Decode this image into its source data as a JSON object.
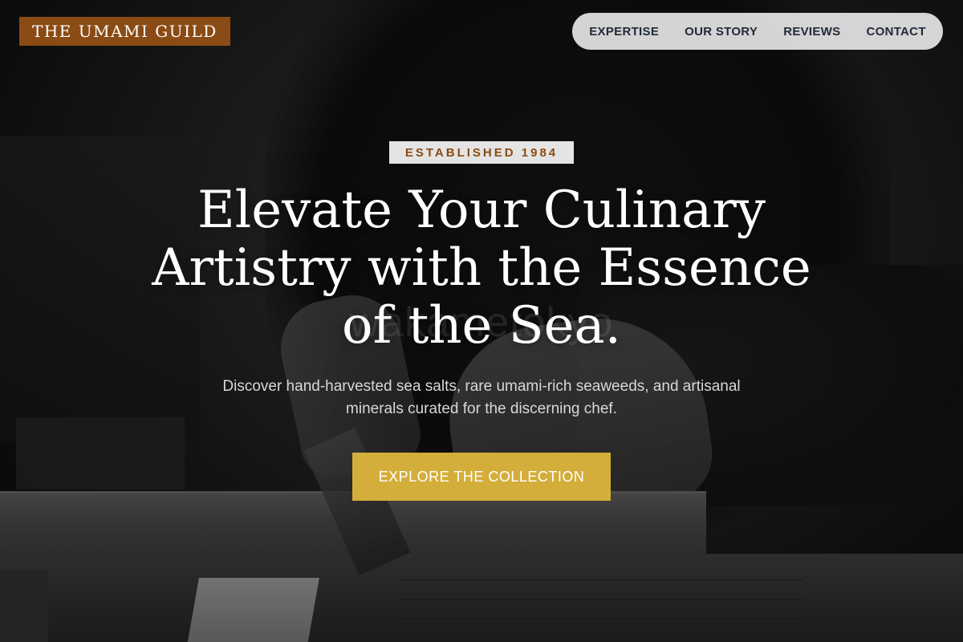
{
  "brand": {
    "logo_text": "THE UMAMI GUILD",
    "colors": {
      "logo_bg": "#8a4b14",
      "accent_gold": "#d4ae3a",
      "badge_text": "#8a4b14"
    }
  },
  "nav": {
    "items": [
      {
        "label": "EXPERTISE"
      },
      {
        "label": "OUR STORY"
      },
      {
        "label": "REVIEWS"
      },
      {
        "label": "CONTACT"
      }
    ]
  },
  "hero": {
    "badge": "ESTABLISHED 1984",
    "headline": "Elevate Your Culinary Artistry with the Essence of the Sea.",
    "watermark": "wakametokyo",
    "subtext": "Discover hand-harvested sea salts, rare umami-rich seaweeds, and artisanal minerals curated for the discerning chef.",
    "cta_label": "EXPLORE THE COLLECTION"
  }
}
